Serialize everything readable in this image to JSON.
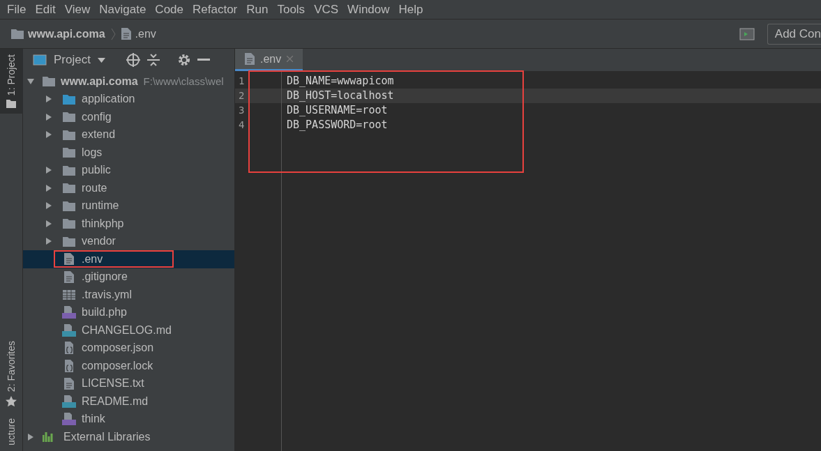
{
  "menu": [
    "File",
    "Edit",
    "View",
    "Navigate",
    "Code",
    "Refactor",
    "Run",
    "Tools",
    "VCS",
    "Window",
    "Help"
  ],
  "breadcrumb": [
    {
      "label": "www.api.coma",
      "kind": "folder"
    },
    {
      "label": ".env",
      "kind": "file"
    }
  ],
  "toolbar": {
    "run_config": "Add Con"
  },
  "tool_strip": [
    {
      "label": "1: Project",
      "kind": "project",
      "selected": true
    },
    {
      "label": "2: Favorites",
      "kind": "favorites",
      "selected": false
    },
    {
      "label": "ucture",
      "kind": "structure",
      "selected": false
    }
  ],
  "project_panel": {
    "title": "Project",
    "root": {
      "label": "www.api.coma",
      "path": "F:\\www\\class\\wel",
      "expanded": true,
      "children": [
        {
          "label": "application",
          "kind": "source",
          "expanded": false,
          "has_children": true,
          "selected": false,
          "highlighted": false
        },
        {
          "label": "config",
          "kind": "folder",
          "expanded": false,
          "has_children": true,
          "selected": false,
          "highlighted": false
        },
        {
          "label": "extend",
          "kind": "folder",
          "expanded": false,
          "has_children": true,
          "selected": false,
          "highlighted": false
        },
        {
          "label": "logs",
          "kind": "folder",
          "has_children": false,
          "selected": false,
          "highlighted": false
        },
        {
          "label": "public",
          "kind": "folder",
          "expanded": false,
          "has_children": true,
          "selected": false,
          "highlighted": false
        },
        {
          "label": "route",
          "kind": "folder",
          "expanded": false,
          "has_children": true,
          "selected": false,
          "highlighted": false
        },
        {
          "label": "runtime",
          "kind": "folder",
          "expanded": false,
          "has_children": true,
          "selected": false,
          "highlighted": false
        },
        {
          "label": "thinkphp",
          "kind": "folder",
          "expanded": false,
          "has_children": true,
          "selected": false,
          "highlighted": false
        },
        {
          "label": "vendor",
          "kind": "folder",
          "expanded": false,
          "has_children": true,
          "selected": false,
          "highlighted": false
        },
        {
          "label": ".env",
          "kind": "text",
          "has_children": false,
          "selected": true,
          "highlighted": true
        },
        {
          "label": ".gitignore",
          "kind": "text",
          "has_children": false,
          "selected": false,
          "highlighted": false
        },
        {
          "label": ".travis.yml",
          "kind": "table",
          "has_children": false,
          "selected": false,
          "highlighted": false
        },
        {
          "label": "build.php",
          "kind": "php",
          "has_children": false,
          "selected": false,
          "highlighted": false
        },
        {
          "label": "CHANGELOG.md",
          "kind": "md",
          "has_children": false,
          "selected": false,
          "highlighted": false
        },
        {
          "label": "composer.json",
          "kind": "json",
          "has_children": false,
          "selected": false,
          "highlighted": false
        },
        {
          "label": "composer.lock",
          "kind": "json",
          "has_children": false,
          "selected": false,
          "highlighted": false
        },
        {
          "label": "LICENSE.txt",
          "kind": "text",
          "has_children": false,
          "selected": false,
          "highlighted": false
        },
        {
          "label": "README.md",
          "kind": "md",
          "has_children": false,
          "selected": false,
          "highlighted": false
        },
        {
          "label": "think",
          "kind": "php",
          "has_children": false,
          "selected": false,
          "highlighted": false
        }
      ]
    },
    "extra": {
      "label": "External Libraries",
      "expanded": false
    }
  },
  "editor": {
    "tabs": [
      {
        "label": ".env",
        "selected": true
      }
    ],
    "highlighted": true,
    "lines": [
      {
        "number": "1",
        "text": "DB_NAME=wwwapicom",
        "current": false
      },
      {
        "number": "2",
        "text": "DB_HOST=localhost",
        "current": true
      },
      {
        "number": "3",
        "text": "DB_USERNAME=root",
        "current": false
      },
      {
        "number": "4",
        "text": "DB_PASSWORD=root",
        "current": false
      }
    ]
  }
}
